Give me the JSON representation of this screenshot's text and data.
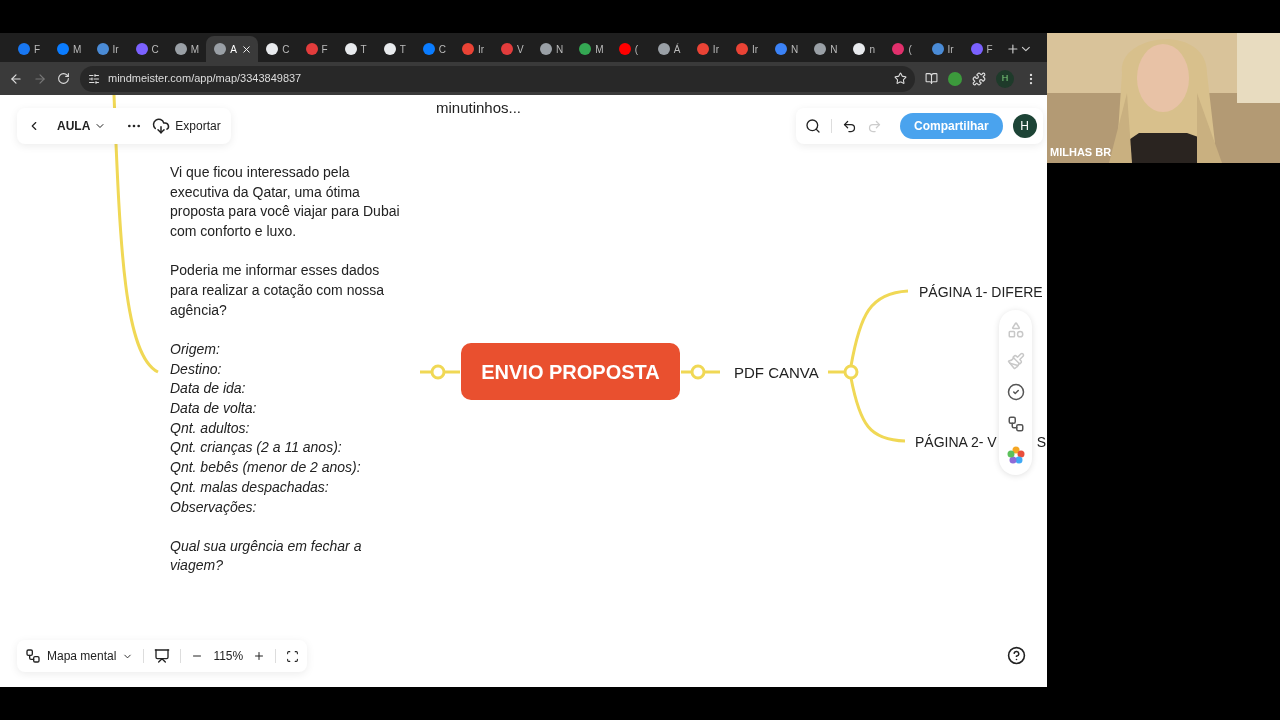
{
  "browser": {
    "tabs": [
      {
        "title": "F",
        "selected": false,
        "color": "#1877f2"
      },
      {
        "title": "M",
        "selected": false,
        "color": "#0a7cff"
      },
      {
        "title": "Ir",
        "selected": false,
        "color": "#4a8bd6"
      },
      {
        "title": "C",
        "selected": false,
        "color": "#7b61ff"
      },
      {
        "title": "M",
        "selected": false,
        "color": "#9aa0a6"
      },
      {
        "title": "A",
        "selected": true,
        "color": "#9aa0a6"
      },
      {
        "title": "C",
        "selected": false,
        "color": "#e8eaed"
      },
      {
        "title": "F",
        "selected": false,
        "color": "#e23c3c"
      },
      {
        "title": "T",
        "selected": false,
        "color": "#e8eaed"
      },
      {
        "title": "T",
        "selected": false,
        "color": "#e8eaed"
      },
      {
        "title": "C",
        "selected": false,
        "color": "#0a7cff"
      },
      {
        "title": "Ir",
        "selected": false,
        "color": "#ea4335"
      },
      {
        "title": "V",
        "selected": false,
        "color": "#e23c3c"
      },
      {
        "title": "N",
        "selected": false,
        "color": "#9aa0a6"
      },
      {
        "title": "M",
        "selected": false,
        "color": "#34a853"
      },
      {
        "title": "(",
        "selected": false,
        "color": "#ff0000"
      },
      {
        "title": "Á",
        "selected": false,
        "color": "#9aa0a6"
      },
      {
        "title": "Ir",
        "selected": false,
        "color": "#ea4335"
      },
      {
        "title": "Ir",
        "selected": false,
        "color": "#ea4335"
      },
      {
        "title": "N",
        "selected": false,
        "color": "#3b82f6"
      },
      {
        "title": "N",
        "selected": false,
        "color": "#9aa0a6"
      },
      {
        "title": "n",
        "selected": false,
        "color": "#e8eaed"
      },
      {
        "title": "(",
        "selected": false,
        "color": "#e1306c"
      },
      {
        "title": "Ir",
        "selected": false,
        "color": "#4a8bd6"
      },
      {
        "title": "F",
        "selected": false,
        "color": "#7b61ff"
      }
    ],
    "url": "mindmeister.com/app/map/3343849837",
    "profile": "H"
  },
  "toolbar": {
    "map_name": "AULA",
    "export": "Exportar",
    "share": "Compartilhar",
    "avatar": "H"
  },
  "map": {
    "top_text": "minutinhos...",
    "note": [
      {
        "text": "Vi que ficou interessado pela executiva da Qatar, uma ótima proposta para você viajar para Dubai com conforto e luxo.",
        "italic": false
      },
      {
        "text": "Poderia me informar esses dados para realizar a cotação com nossa agência?",
        "italic": false
      },
      {
        "lines": [
          "Origem:",
          "Destino:",
          "Data de ida:",
          "Data de volta:",
          "Qnt. adultos:",
          "Qnt. crianças (2 a 11 anos):",
          "Qnt. bebês (menor de 2 anos):",
          "Qnt. malas despachadas:",
          "Observações:"
        ],
        "italic": true
      },
      {
        "text": "Qual sua urgência em fechar a viagem?",
        "italic": true
      }
    ],
    "central": "ENVIO PROPOSTA",
    "child": "PDF CANVA",
    "leaves": [
      {
        "parts": [
          "PÁGINA 1- DIFERE"
        ]
      },
      {
        "parts": [
          "PÁGINA 2- V",
          "S"
        ]
      }
    ]
  },
  "bottom_bar": {
    "view": "Mapa mental",
    "zoom": "115%"
  },
  "webcam": {
    "name": "MILHAS BR"
  }
}
